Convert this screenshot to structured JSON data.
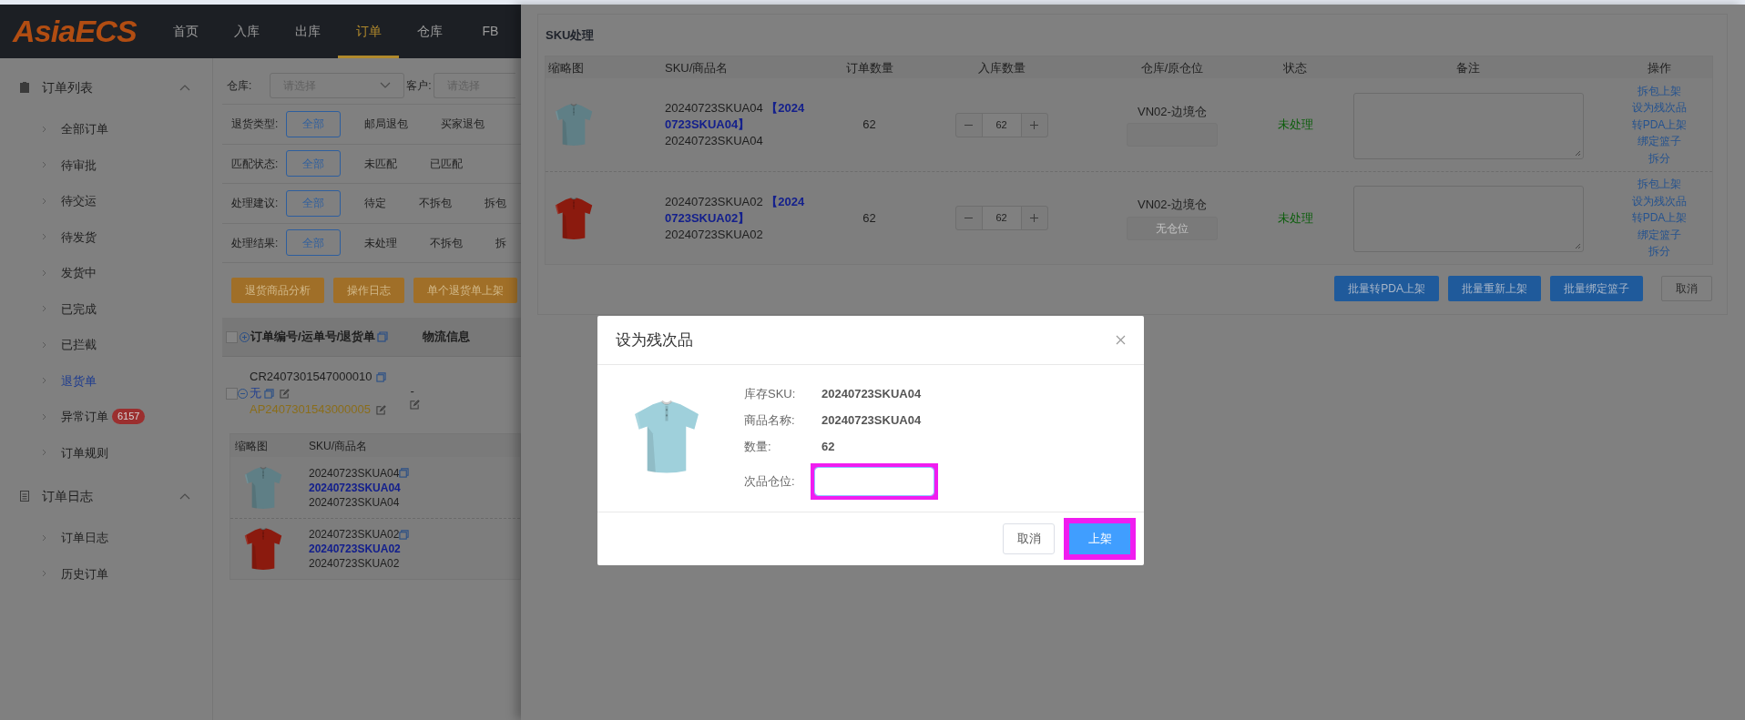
{
  "header": {
    "logo": "AsiaECS",
    "nav": [
      {
        "label": "首页",
        "selected": false
      },
      {
        "label": "入库",
        "selected": false
      },
      {
        "label": "出库",
        "selected": false
      },
      {
        "label": "订单",
        "selected": true
      },
      {
        "label": "仓库",
        "selected": false
      },
      {
        "label": "FB",
        "selected": false
      }
    ]
  },
  "sidebar": {
    "groups": [
      {
        "label": "订单列表",
        "expanded": true,
        "items": [
          {
            "label": "全部订单",
            "selected": false
          },
          {
            "label": "待审批",
            "selected": false
          },
          {
            "label": "待交运",
            "selected": false
          },
          {
            "label": "待发货",
            "selected": false
          },
          {
            "label": "发货中",
            "selected": false
          },
          {
            "label": "已完成",
            "selected": false
          },
          {
            "label": "已拦截",
            "selected": false
          },
          {
            "label": "退货单",
            "selected": true
          },
          {
            "label": "异常订单",
            "selected": false,
            "badge": "6157"
          },
          {
            "label": "订单规则",
            "selected": false
          }
        ]
      },
      {
        "label": "订单日志",
        "expanded": true,
        "items": [
          {
            "label": "订单日志",
            "selected": false
          },
          {
            "label": "历史订单",
            "selected": false
          }
        ]
      }
    ]
  },
  "filters": {
    "warehouse": {
      "label": "仓库:",
      "placeholder": "请选择"
    },
    "customer": {
      "label": "客户:",
      "placeholder": "请选择"
    },
    "rows": [
      {
        "label": "退货类型:",
        "options": [
          {
            "label": "全部",
            "selected": true
          },
          {
            "label": "邮局退包",
            "selected": false
          },
          {
            "label": "买家退包",
            "selected": false
          }
        ]
      },
      {
        "label": "匹配状态:",
        "options": [
          {
            "label": "全部",
            "selected": true
          },
          {
            "label": "未匹配",
            "selected": false
          },
          {
            "label": "已匹配",
            "selected": false
          }
        ]
      },
      {
        "label": "处理建议:",
        "options": [
          {
            "label": "全部",
            "selected": true
          },
          {
            "label": "待定",
            "selected": false
          },
          {
            "label": "不拆包",
            "selected": false
          },
          {
            "label": "拆包",
            "selected": false
          }
        ]
      },
      {
        "label": "处理结果:",
        "options": [
          {
            "label": "全部",
            "selected": true
          },
          {
            "label": "未处理",
            "selected": false
          },
          {
            "label": "不拆包",
            "selected": false
          },
          {
            "label": "拆",
            "selected": false
          }
        ]
      }
    ]
  },
  "actions": [
    "退货商品分析",
    "操作日志",
    "单个退货单上架"
  ],
  "orders": {
    "select_all_checked": false,
    "columns": [
      "订单编号/运单号/退货单",
      "物流信息"
    ],
    "rows": [
      {
        "checked": false,
        "order_no": "CR2407301547000010",
        "tracking_no": "无",
        "return_no": "AP2407301543000005",
        "logistics": "-",
        "items": {
          "columns": [
            "缩略图",
            "SKU/商品名"
          ],
          "rows": [
            {
              "sku": "20240723SKUA04",
              "code": "20240723SKUA04",
              "name": "20240723SKUA04"
            },
            {
              "sku": "20240723SKUA02",
              "code": "20240723SKUA02",
              "name": "20240723SKUA02"
            }
          ]
        }
      }
    ]
  },
  "sku_panel": {
    "title": "SKU处理",
    "columns": [
      "缩略图",
      "SKU/商品名",
      "订单数量",
      "入库数量",
      "仓库/原仓位",
      "状态",
      "备注",
      "操作"
    ],
    "rows": [
      {
        "sku": "20240723SKUA04",
        "code": "【20240723SKUA04】",
        "name": "20240723SKUA04",
        "order_qty": "62",
        "in_qty": "62",
        "warehouse": "VN02-边境仓",
        "status": "未处理",
        "actions": [
          "拆包上架",
          "设为残次品",
          "转PDA上架",
          "绑定篮子",
          "拆分"
        ]
      },
      {
        "sku": "20240723SKUA02",
        "code": "【20240723SKUA02】",
        "name": "20240723SKUA02",
        "order_qty": "62",
        "in_qty": "62",
        "warehouse": "VN02-边境仓",
        "location_placeholder": "无仓位",
        "status": "未处理",
        "actions": [
          "拆包上架",
          "设为残次品",
          "转PDA上架",
          "绑定篮子",
          "拆分"
        ]
      }
    ],
    "buttons": [
      {
        "label": "批量转PDA上架",
        "kind": "primary"
      },
      {
        "label": "批量重新上架",
        "kind": "primary"
      },
      {
        "label": "批量绑定篮子",
        "kind": "primary"
      },
      {
        "label": "取消",
        "kind": "default"
      }
    ]
  },
  "dialog": {
    "title": "设为残次品",
    "fields": [
      {
        "label": "库存SKU:",
        "value": "20240723SKUA04"
      },
      {
        "label": "商品名称:",
        "value": "20240723SKUA04"
      },
      {
        "label": "数量:",
        "value": "62"
      }
    ],
    "location_input": {
      "label": "次品仓位:",
      "highlighted": true
    },
    "buttons": [
      {
        "label": "取消",
        "kind": "default",
        "highlighted": false
      },
      {
        "label": "上架",
        "kind": "primary",
        "highlighted": true
      }
    ]
  }
}
